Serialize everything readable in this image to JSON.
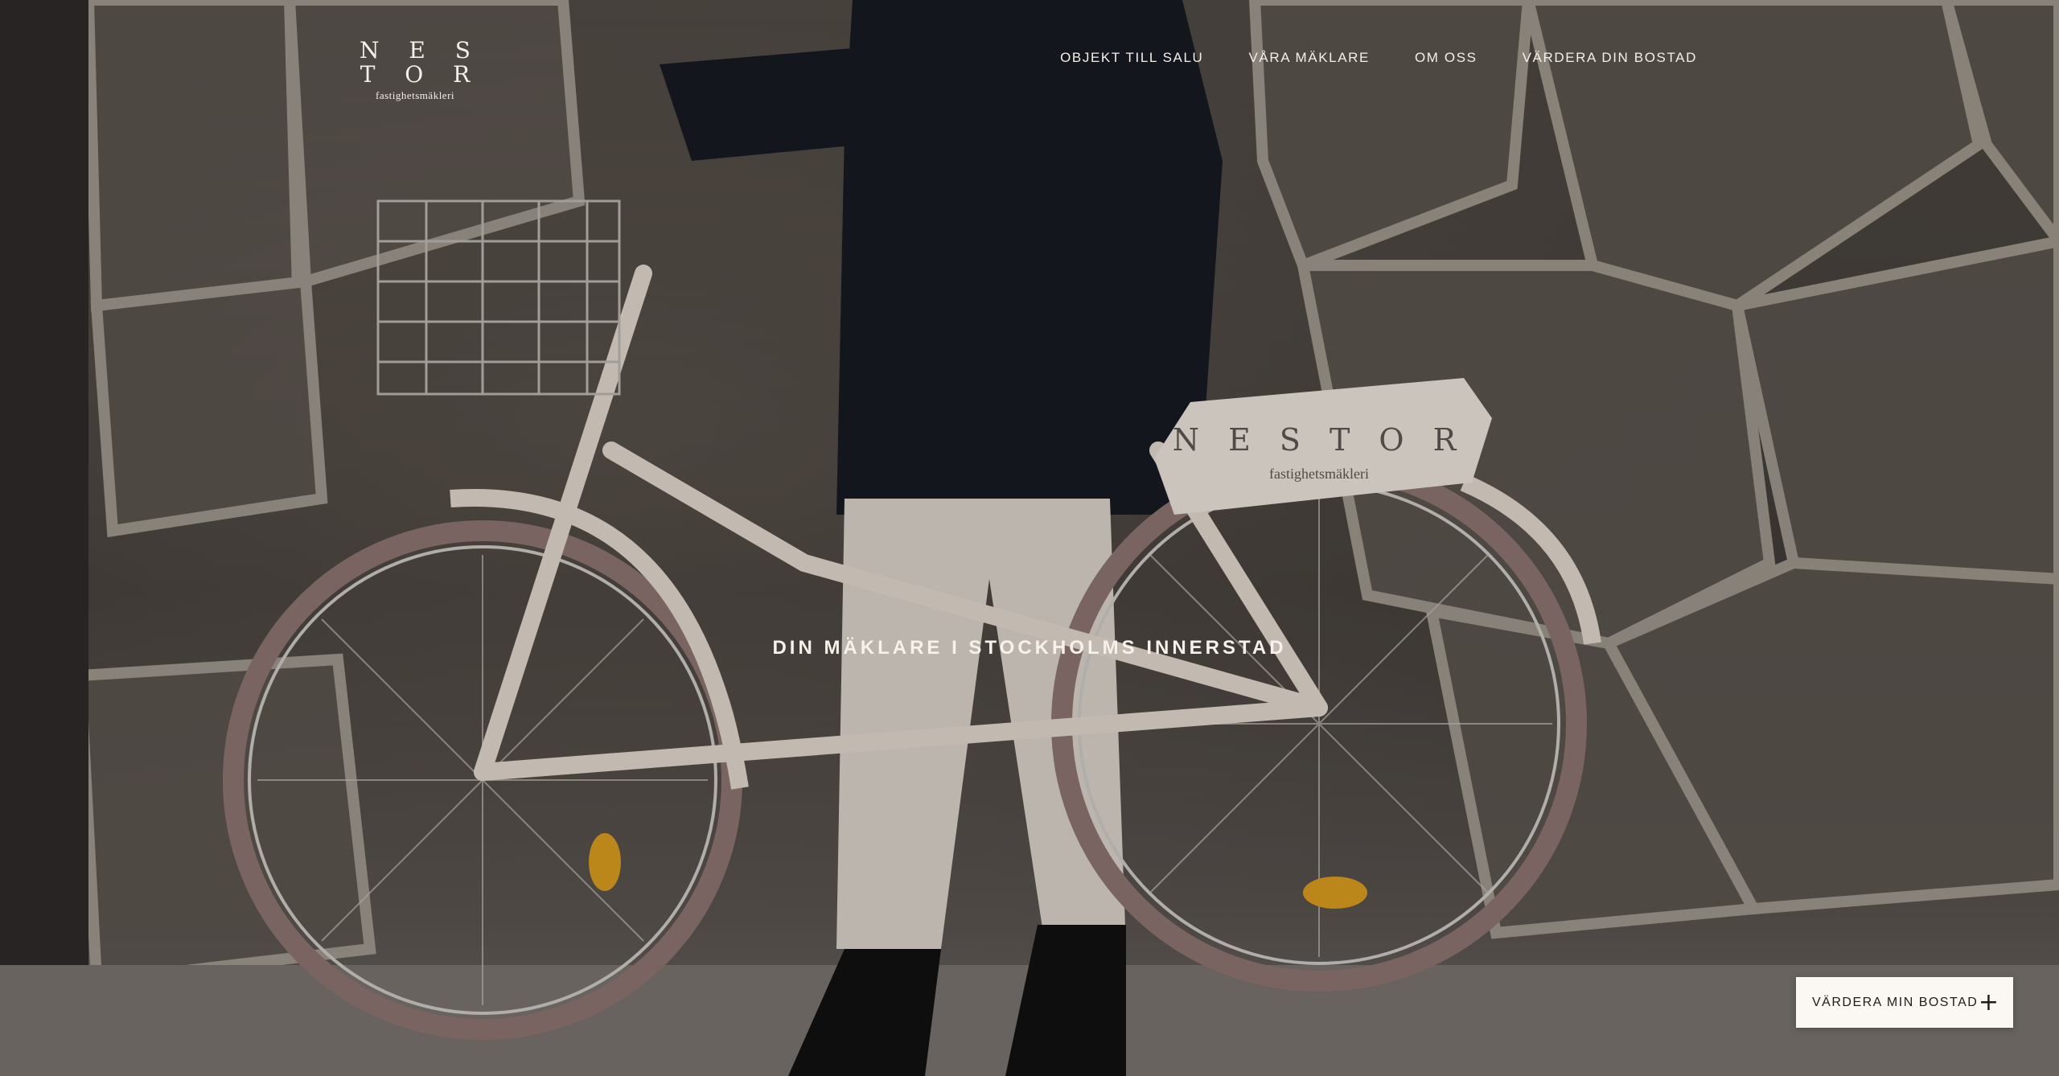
{
  "brand": {
    "name": "N E S T O R",
    "subtitle": "fastighetsmäkleri"
  },
  "nav": {
    "items": [
      {
        "label": "OBJEKT TILL SALU"
      },
      {
        "label": "VÅRA MÄKLARE"
      },
      {
        "label": "OM OSS"
      },
      {
        "label": "VÄRDERA DIN BOSTAD"
      }
    ]
  },
  "hero": {
    "tagline": "DIN MÄKLARE I STOCKHOLMS INNERSTAD",
    "sign_text": "N E S T O R",
    "sign_subtext": "fastighetsmäkleri"
  },
  "cta": {
    "label": "VÄRDERA MIN BOSTAD",
    "icon": "plus-icon"
  },
  "colors": {
    "text_light": "#f4efe8",
    "cta_bg": "#fbf8f3",
    "cta_text": "#1f1c1a"
  }
}
